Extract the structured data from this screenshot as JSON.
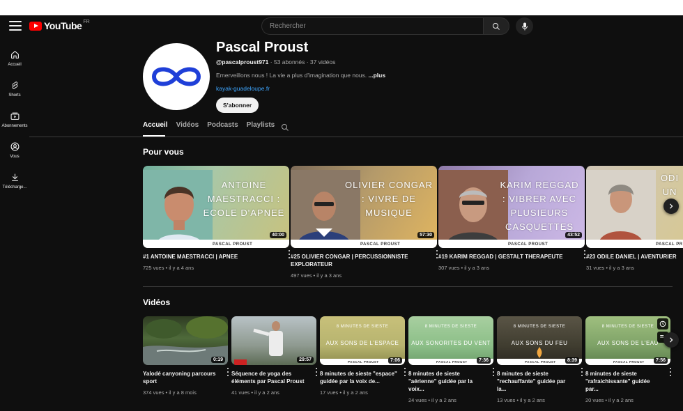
{
  "header": {
    "logo_text": "YouTube",
    "country": "FR",
    "search_placeholder": "Rechercher"
  },
  "sidebar": {
    "items": [
      {
        "label": "Accueil",
        "icon": "home-icon"
      },
      {
        "label": "Shorts",
        "icon": "shorts-icon"
      },
      {
        "label": "Abonnements",
        "icon": "subscriptions-icon"
      },
      {
        "label": "Vous",
        "icon": "you-icon"
      },
      {
        "label": "Télécharge...",
        "icon": "download-icon"
      }
    ]
  },
  "channel": {
    "name": "Pascal Proust",
    "handle": "@pascalproust971",
    "stats": " · 53 abonnés · 37 vidéos",
    "description": "Emerveillons nous ! La vie a plus d'imagination que nous. ",
    "more": "...plus",
    "link": "kayak-guadeloupe.fr",
    "subscribe_label": "S'abonner",
    "accent": "#1f3fd8"
  },
  "tabs": [
    {
      "label": "Accueil"
    },
    {
      "label": "Vidéos"
    },
    {
      "label": "Podcasts"
    },
    {
      "label": "Playlists"
    }
  ],
  "for_you": {
    "title": "Pour vous",
    "videos": [
      {
        "thumb_title": "ANTOINE MAESTRACCI : ECOLE D'APNEE",
        "brand": "PASCAL PROUST",
        "duration": "40:00",
        "title": "#1 ANTOINE MAESTRACCI | APNEE",
        "meta": "725 vues • il y a 4 ans"
      },
      {
        "thumb_title": "OLIVIER CONGAR : VIVRE DE MUSIQUE",
        "brand": "PASCAL PROUST",
        "duration": "57:30",
        "title": "#25 OLIVIER CONGAR | PERCUSSIONNISTE EXPLORATEUR",
        "meta": "497 vues • il y a 3 ans"
      },
      {
        "thumb_title": "KARIM REGGAD : VIBRER AVEC PLUSIEURS CASQUETTES",
        "brand": "PASCAL PROUST",
        "duration": "43:52",
        "title": "#19 KARIM REGGAD | GESTALT THERAPEUTE",
        "meta": "307 vues • il y a 3 ans"
      },
      {
        "thumb_title": "ODI UN",
        "brand": "PASCAL PR",
        "duration": "",
        "title": "#23 ODILE DANIEL | AVENTURIER",
        "meta": "31 vues • il y a 3 ans"
      }
    ]
  },
  "videos_section": {
    "title": "Vidéos",
    "videos": [
      {
        "thumb_top": "",
        "thumb_main": "",
        "duration": "0:19",
        "title": "Yalodé canyoning parcours sport",
        "meta": "374 vues • il y a 8 mois"
      },
      {
        "thumb_top": "",
        "thumb_main": "",
        "duration": "29:57",
        "title": "Séquence de yoga des éléments par Pascal Proust",
        "meta": "41 vues • il y a 2 ans"
      },
      {
        "thumb_top": "8 MINUTES DE SIESTE",
        "thumb_main": "AUX SONS DE L'ESPACE",
        "duration": "7:06",
        "title": "8 minutes de sieste \"espace\" guidée par la voix de...",
        "meta": "17 vues • il y a 2 ans"
      },
      {
        "thumb_top": "8 MINUTES DE SIESTE",
        "thumb_main": "AUX SONORITES DU VENT",
        "duration": "7:36",
        "title": "8 minutes de sieste \"aérienne\" guidée par la voix...",
        "meta": "24 vues • il y a 2 ans"
      },
      {
        "thumb_top": "8 MINUTES DE SIESTE",
        "thumb_main": "AUX SONS DU FEU",
        "duration": "8:39",
        "title": "8 minutes de sieste \"rechauffante\" guidée par la...",
        "meta": "13 vues • il y a 2 ans"
      },
      {
        "thumb_top": "8 MINUTES DE SIESTE",
        "thumb_main": "AUX SONS DE L'EAU",
        "duration": "7:56",
        "title": "8 minutes de sieste \"rafraichissante\" guidée par...",
        "meta": "20 vues • il y a 2 ans"
      }
    ],
    "brand": "PASCAL PROUST"
  }
}
